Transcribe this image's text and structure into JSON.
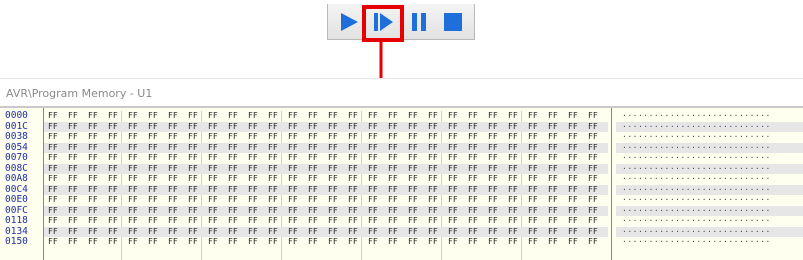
{
  "toolbar": {
    "buttons": [
      {
        "name": "run-button",
        "icon": "play-icon"
      },
      {
        "name": "step-button",
        "icon": "step-forward-icon"
      },
      {
        "name": "pause-button",
        "icon": "pause-icon"
      },
      {
        "name": "stop-button",
        "icon": "stop-icon"
      }
    ],
    "icon_color": "#1e6fd9",
    "highlight_color": "#e60000"
  },
  "panel": {
    "title": "AVR\\Program Memory - U1"
  },
  "memory": {
    "addresses": [
      "0000",
      "001C",
      "0038",
      "0054",
      "0070",
      "008C",
      "00A8",
      "00C4",
      "00E0",
      "00FC",
      "0118",
      "0134",
      "0150"
    ],
    "bytes_per_row": 28,
    "byte_value": "FF",
    "ascii_value": "............................",
    "shaded_rows": [
      1,
      3,
      5,
      7,
      9,
      11
    ]
  }
}
